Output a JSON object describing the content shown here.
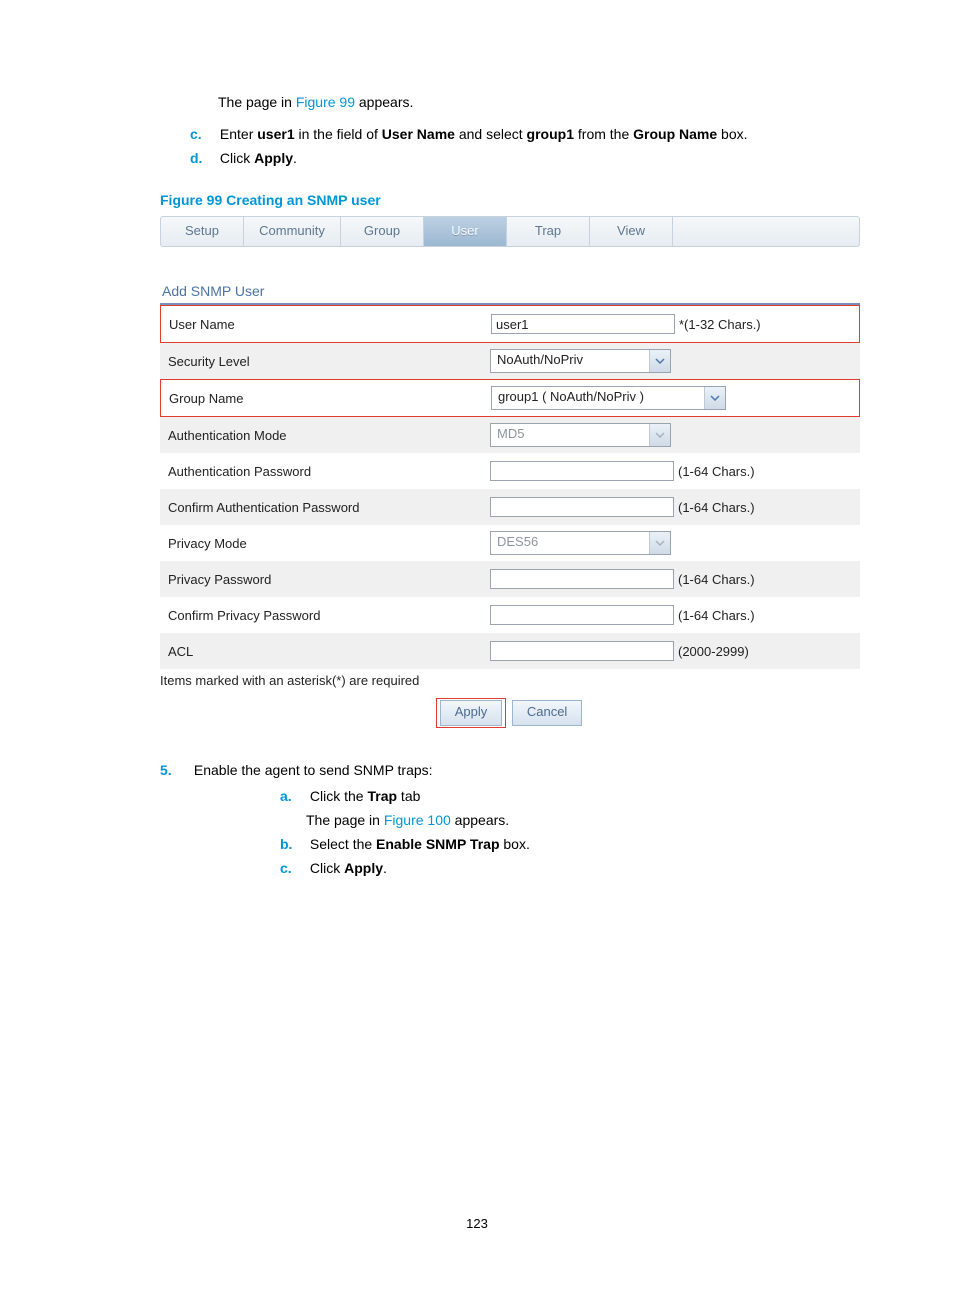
{
  "intro": {
    "line1_a": "The page in ",
    "line1_link": "Figure 99",
    "line1_b": " appears."
  },
  "steps_cd": {
    "c": {
      "letter": "c.",
      "pre": "Enter ",
      "strong1": "user1",
      "mid1": " in the field of ",
      "strong2": "User Name",
      "mid2": " and select ",
      "strong3": "group1",
      "mid3": " from the ",
      "strong4": "Group Name",
      "post": " box."
    },
    "d": {
      "letter": "d.",
      "pre": "Click ",
      "strong": "Apply",
      "post": "."
    }
  },
  "figure_label": "Figure 99 Creating an SNMP user",
  "tabs": {
    "setup": "Setup",
    "community": "Community",
    "group": "Group",
    "user": "User",
    "trap": "Trap",
    "view": "View"
  },
  "section_title": "Add SNMP User",
  "form": {
    "user_name_label": "User Name",
    "user_name_value": "user1",
    "user_name_hint": "*(1-32 Chars.)",
    "security_level_label": "Security Level",
    "security_level_value": "NoAuth/NoPriv",
    "group_name_label": "Group Name",
    "group_name_value": "group1 ( NoAuth/NoPriv )",
    "auth_mode_label": "Authentication Mode",
    "auth_mode_value": "MD5",
    "auth_pw_label": "Authentication Password",
    "confirm_auth_pw_label": "Confirm Authentication Password",
    "priv_mode_label": "Privacy Mode",
    "priv_mode_value": "DES56",
    "priv_pw_label": "Privacy Password",
    "confirm_priv_pw_label": "Confirm Privacy Password",
    "acl_label": "ACL",
    "hint_1_64": "(1-64 Chars.)",
    "hint_acl": "(2000-2999)"
  },
  "note": "Items marked with an asterisk(*) are required",
  "buttons": {
    "apply": "Apply",
    "cancel": "Cancel"
  },
  "step5": {
    "num": "5.",
    "text": "Enable the agent to send SNMP traps:",
    "a": {
      "letter": "a.",
      "pre": "Click the ",
      "strong": "Trap",
      "post": " tab"
    },
    "a2_a": "The page in ",
    "a2_link": "Figure 100",
    "a2_b": " appears.",
    "b": {
      "letter": "b.",
      "pre": "Select the ",
      "strong": "Enable SNMP Trap",
      "post": " box."
    },
    "c": {
      "letter": "c.",
      "pre": "Click ",
      "strong": "Apply",
      "post": "."
    }
  },
  "page_number": "123"
}
